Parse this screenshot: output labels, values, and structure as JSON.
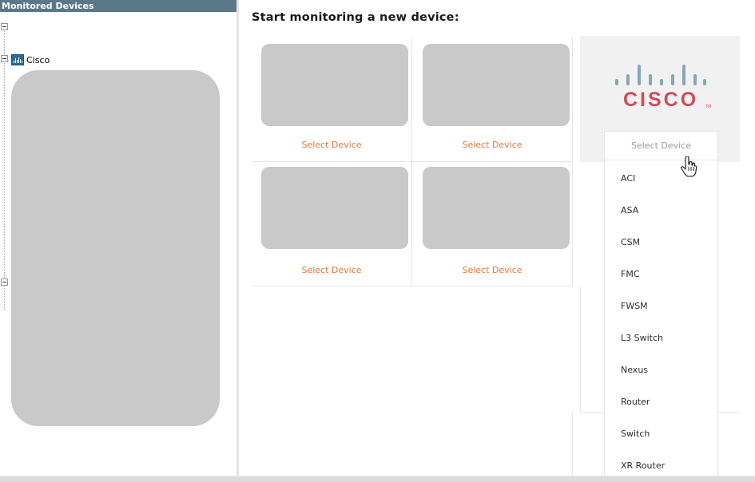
{
  "left_panel": {
    "header": "Monitored Devices",
    "tree": {
      "nodes": [
        {
          "label": "",
          "expanded": true
        },
        {
          "label": "Cisco",
          "icon": "device-group-icon",
          "expanded": true
        },
        {
          "label": "",
          "expanded": true
        }
      ]
    }
  },
  "main": {
    "title": "Start monitoring a new device:",
    "tiles": [
      {
        "link": "Select Device"
      },
      {
        "link": "Select Device"
      },
      {
        "link": "Select Device"
      },
      {
        "link": "Select Device"
      }
    ],
    "vendor_tile": {
      "logo_text": "CISCO",
      "logo_tm": "TM",
      "dropdown": {
        "selected": "Select Device",
        "options": [
          "ACI",
          "ASA",
          "CSM",
          "FMC",
          "FWSM",
          "L3 Switch",
          "Nexus",
          "Router",
          "Switch",
          "XR Router"
        ]
      }
    }
  },
  "colors": {
    "header_bg": "#5b7888",
    "link": "#e8773a",
    "cisco_red": "#cc4d5b",
    "cisco_bars": "#8aa6b3"
  }
}
